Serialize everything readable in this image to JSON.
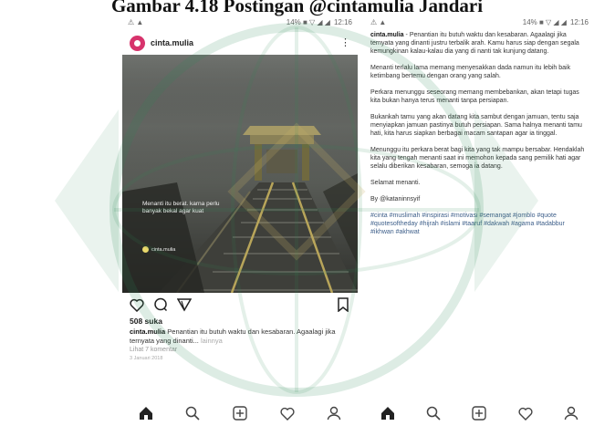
{
  "doc_title": "Gambar 4.18 Postingan @cintamulia Jandari",
  "status_bar": {
    "left": {
      "time": "12:16",
      "signal": "14% ■ ▽ ◢ ◢"
    },
    "right": {
      "time": "12:16",
      "signal": "14% ■ ▽ ◢ ◢"
    }
  },
  "post": {
    "username": "cinta.mulia",
    "image_caption": "Menanti itu berat. karna perlu banyak bekal agar kuat",
    "image_tag": "cinta.mulia",
    "likes": "508 suka",
    "caption_user": "cinta.mulia",
    "caption_text": "Penantian itu butuh waktu dan kesabaran. Agaalagi jika ternyata yang dinanti...",
    "caption_more": "lainnya",
    "comments": "Lihat 7 komentar",
    "date": "3 Januari 2018"
  },
  "caption_full": {
    "p1_user": "cinta.mulia",
    "p1": "Penantian itu butuh waktu dan kesabaran. Agaalagi jika ternyata yang dinanti justru terbalik arah. Kamu harus siap dengan segala kemungkinan kalau-kalau dia yang di nanti tak kunjung datang.",
    "p2": "Menanti terlalu lama memang menyesakkan dada namun itu lebih baik ketimbang bertemu dengan orang yang salah.",
    "p3": "Perkara menunggu seseorang memang membebankan, akan tetapi tugas kita bukan hanya terus menanti tanpa persiapan.",
    "p4": "Bukankah tamu yang akan datang kita sambut dengan jamuan, tentu saja menyiapkan jamuan pastinya butuh persiapan. Sama halnya menanti tamu hati, kita harus siapkan berbagai macam santapan agar ia tinggal.",
    "p5": "Menunggu itu perkara berat bagi kita yang tak mampu bersabar. Hendaklah kita yang tengah menanti saat ini memohon kepada sang pemilik hati agar selalu diberikan kesabaran, semoga ia datang.",
    "p6": "Selamat menanti.",
    "p7": "By @kataninnsyif",
    "hashtags": "#cinta #muslimah #inspirasi #motivasi #semangat #jomblo #quote #quotesoftheday #hijrah #islami #taaruf #dakwah #agama #tadabbur #ikhwan #akhwat"
  },
  "colors": {
    "avatar": "#d7336c",
    "tag_dot": "#e9d86b",
    "hashtag": "#3e5f8a",
    "watermark": "#2e8b57"
  },
  "nav_icons": [
    "home-icon",
    "search-icon",
    "add-post-icon",
    "activity-heart-icon",
    "profile-icon"
  ]
}
